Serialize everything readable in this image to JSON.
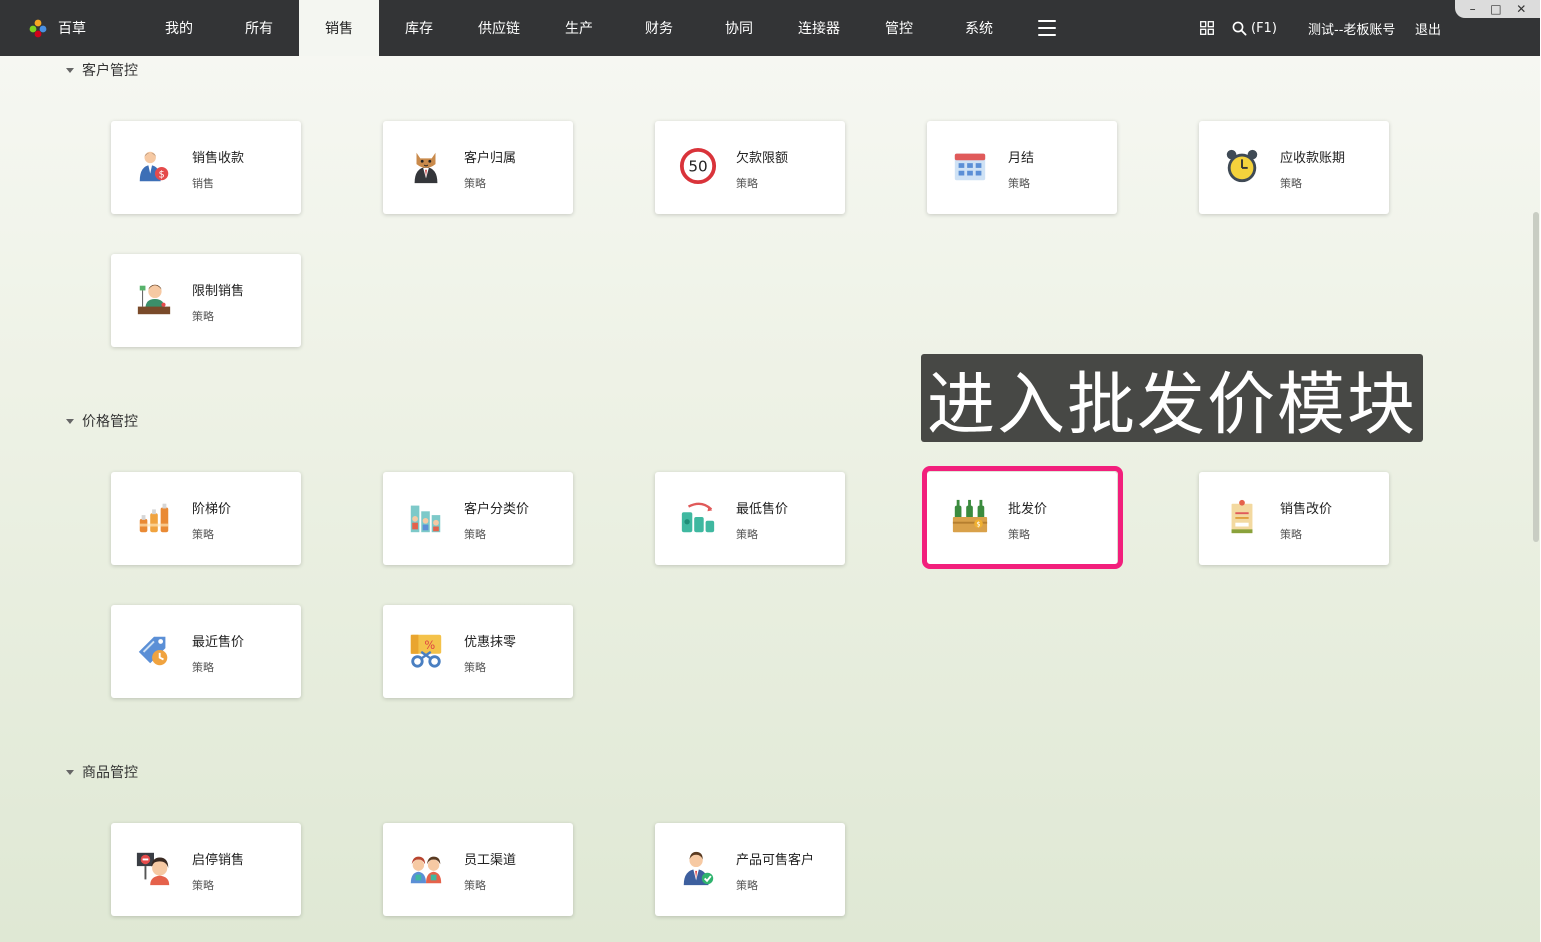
{
  "app": {
    "name": "百草",
    "nav": [
      "我的",
      "所有",
      "销售",
      "库存",
      "供应链",
      "生产",
      "财务",
      "协同",
      "连接器",
      "管控",
      "系统"
    ],
    "active_nav_index": 2,
    "search_label": "(F1)",
    "account": "测试--老板账号",
    "logout": "退出"
  },
  "window_controls": {
    "minimize": "–",
    "maximize": "□",
    "close": "✕"
  },
  "sections": [
    {
      "title": "客户管控",
      "cards": [
        {
          "title": "销售收款",
          "subtitle": "销售",
          "icon": "salesperson-payment-icon"
        },
        {
          "title": "客户归属",
          "subtitle": "策略",
          "icon": "cat-customer-icon"
        },
        {
          "title": "欠款限额",
          "subtitle": "策略",
          "icon": "speed-limit-50-icon",
          "icon_text": "50"
        },
        {
          "title": "月结",
          "subtitle": "策略",
          "icon": "calendar-icon"
        },
        {
          "title": "应收款账期",
          "subtitle": "策略",
          "icon": "alarm-clock-icon"
        },
        {
          "title": "限制销售",
          "subtitle": "策略",
          "icon": "shop-keeper-icon"
        }
      ]
    },
    {
      "title": "价格管控",
      "cards": [
        {
          "title": "阶梯价",
          "subtitle": "策略",
          "icon": "tiered-bottles-icon"
        },
        {
          "title": "客户分类价",
          "subtitle": "策略",
          "icon": "customer-groups-icon"
        },
        {
          "title": "最低售价",
          "subtitle": "策略",
          "icon": "lowest-price-icon"
        },
        {
          "title": "批发价",
          "subtitle": "策略",
          "icon": "wholesale-bottles-icon"
        },
        {
          "title": "销售改价",
          "subtitle": "策略",
          "icon": "price-tag-edit-icon"
        },
        {
          "title": "最近售价",
          "subtitle": "策略",
          "icon": "recent-price-tag-icon"
        },
        {
          "title": "优惠抹零",
          "subtitle": "策略",
          "icon": "discount-coupon-icon"
        }
      ]
    },
    {
      "title": "商品管控",
      "cards": [
        {
          "title": "启停销售",
          "subtitle": "策略",
          "icon": "stop-sign-person-icon"
        },
        {
          "title": "员工渠道",
          "subtitle": "策略",
          "icon": "staff-channel-icon"
        },
        {
          "title": "产品可售客户",
          "subtitle": "策略",
          "icon": "sellable-customer-icon"
        }
      ]
    }
  ],
  "overlay": {
    "text": "进入批发价模块"
  },
  "colors": {
    "topbar": "#333436",
    "highlight": "#f21f7c",
    "overlay_bg": "#474845"
  }
}
